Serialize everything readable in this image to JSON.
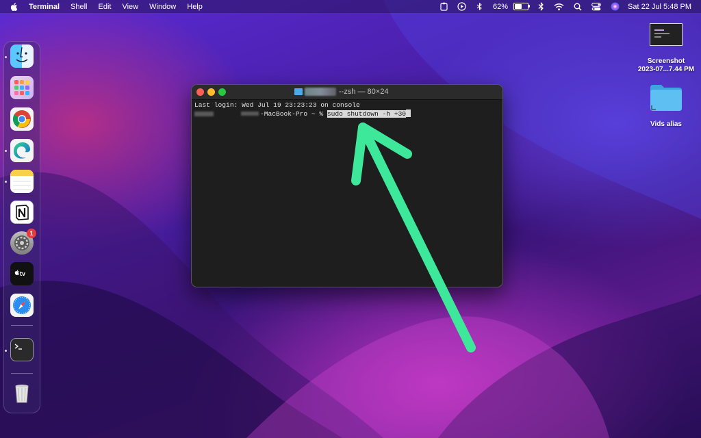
{
  "menubar": {
    "app_name": "Terminal",
    "items": [
      "Shell",
      "Edit",
      "View",
      "Window",
      "Help"
    ],
    "battery_percent": "62%",
    "battery_level": 0.62,
    "datetime": "Sat 22 Jul  5:48 PM",
    "status_icons": [
      "clipboard-icon",
      "play-icon",
      "bluetooth-alt-icon",
      "bluetooth-icon",
      "wifi-icon",
      "search-icon",
      "control-center-icon",
      "siri-icon"
    ]
  },
  "desktop_icons": [
    {
      "name": "screenshot",
      "label_line1": "Screenshot",
      "label_line2": "2023-07...7.44 PM"
    },
    {
      "name": "vids-alias",
      "label": "Vids alias"
    }
  ],
  "dock": {
    "apps": [
      "finder",
      "launchpad",
      "chrome",
      "edge",
      "notes",
      "notion",
      "system-settings",
      "apple-tv",
      "safari",
      "terminal",
      "trash"
    ],
    "settings_badge": "1"
  },
  "terminal": {
    "title": "--zsh — 80×24",
    "last_login": "Last login: Wed Jul 19 23:23:23 on console",
    "prompt_host": "-MacBook-Pro ~ % ",
    "command": "sudo shutdown -h +30"
  },
  "colors": {
    "arrow": "#3ee89a",
    "close": "#ff5f57",
    "minimize": "#febc2e",
    "zoom": "#28c840"
  }
}
